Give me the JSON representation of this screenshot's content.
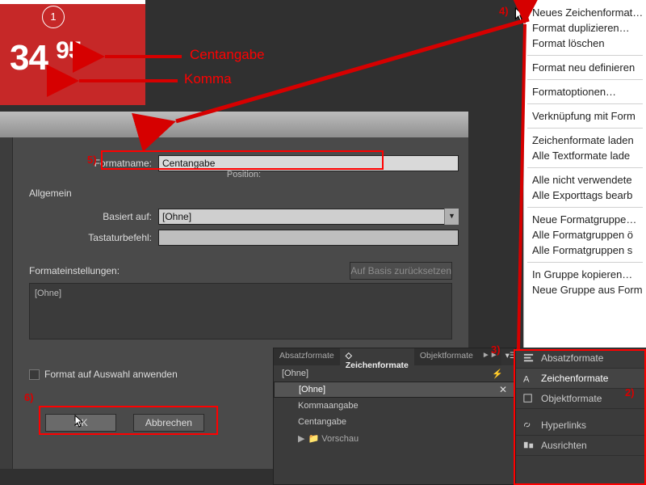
{
  "ad": {
    "badge": "1",
    "whole": "34",
    "comma": ",",
    "cents": "95"
  },
  "annot": {
    "cent": "Centangabe",
    "komma": "Komma",
    "n4": "4)",
    "n5": "5)",
    "n6": "6)",
    "n3": "3)",
    "n2": "2)"
  },
  "dialog": {
    "lbl_name": "Formatname:",
    "val_name": "Centangabe",
    "lbl_pos": "Position:",
    "sec_general": "Allgemein",
    "lbl_based": "Basiert auf:",
    "val_based": "[Ohne]",
    "lbl_shortcut": "Tastaturbefehl:",
    "val_shortcut": "",
    "sec_settings": "Formateinstellungen:",
    "btn_reset": "Auf Basis zurücksetzen",
    "list0": "[Ohne]",
    "chk_apply": "Format auf Auswahl anwenden",
    "btn_ok": "OK",
    "btn_cancel": "Abbrechen"
  },
  "ctx": {
    "m0": "Neues Zeichenformat…",
    "m1": "Format duplizieren…",
    "m2": "Format löschen",
    "m3": "Format neu definieren",
    "m4": "Formatoptionen…",
    "m5": "Verknüpfung mit Form",
    "m6": "Zeichenformate laden",
    "m7": "Alle Textformate lade",
    "m8": "Alle nicht verwendete",
    "m9": "Alle Exporttags bearb",
    "m10": "Neue Formatgruppe…",
    "m11": "Alle Formatgruppen ö",
    "m12": "Alle Formatgruppen s",
    "m13": "In Gruppe kopieren…",
    "m14": "Neue Gruppe aus Form"
  },
  "zpanel": {
    "t0": "Absatzformate",
    "t1": "Zeichenformate",
    "t2": "Objektformate",
    "r_ohne": "[Ohne]",
    "r_ohne2": "[Ohne]",
    "r_komma": "Kommaangabe",
    "r_cent": "Centangabe",
    "r_vorschau": "Vorschau",
    "expand": "►►",
    "menuicon": "▤"
  },
  "dock": {
    "d0": "Absatzformate",
    "d1": "Zeichenformate",
    "d2": "Objektformate",
    "d3": "Hyperlinks",
    "d4": "Ausrichten"
  }
}
